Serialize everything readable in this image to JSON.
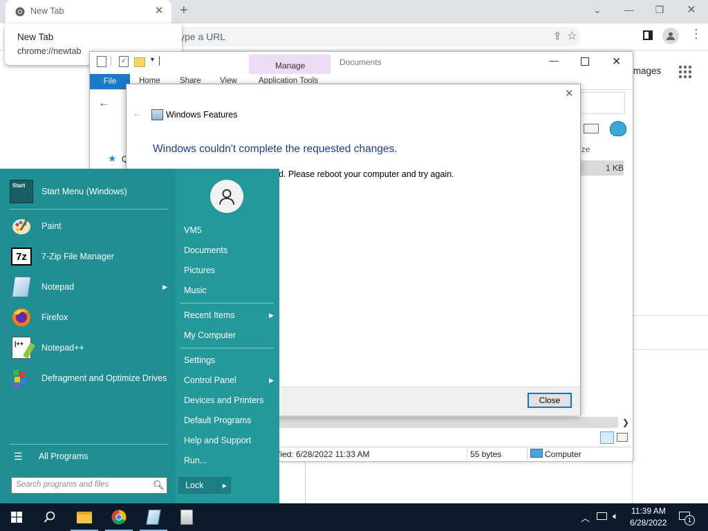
{
  "chrome": {
    "tab_title": "New Tab",
    "tooltip_title": "New Tab",
    "tooltip_url": "chrome://newtab",
    "omnibox_placeholder": "ype a URL",
    "images_link": "Images"
  },
  "explorer": {
    "title": "Documents",
    "manage_label": "Manage",
    "ribbon_tabs": [
      "File",
      "Home",
      "Share",
      "View",
      "Application Tools"
    ],
    "nav_partial": "Q",
    "column_header_partial": "ize",
    "file_size": "1 KB",
    "status": {
      "modified": "fied: 6/28/2022 11:33 AM",
      "size": "55 bytes",
      "location": "Computer"
    }
  },
  "dialog": {
    "title": "Windows Features",
    "heading": "Windows couldn't complete the requested changes.",
    "message": "d. Please reboot your computer and try again.",
    "close_label": "Close"
  },
  "start_menu": {
    "pinned": [
      {
        "label": "Start Menu (Windows)",
        "icon": "start-menu-icon"
      },
      {
        "label": "Paint",
        "icon": "paint-icon"
      },
      {
        "label": "7-Zip File Manager",
        "icon": "7zip-icon"
      },
      {
        "label": "Notepad",
        "icon": "notepad-icon",
        "submenu": true
      },
      {
        "label": "Firefox",
        "icon": "firefox-icon"
      },
      {
        "label": "Notepad++",
        "icon": "notepadpp-icon"
      },
      {
        "label": "Defragment and Optimize Drives",
        "icon": "defrag-icon"
      }
    ],
    "all_programs": "All Programs",
    "search_placeholder": "Search programs and files",
    "user_name": "VM5",
    "right_items": [
      "Documents",
      "Pictures",
      "Music",
      "Recent Items",
      "My Computer",
      "Settings",
      "Control Panel",
      "Devices and Printers",
      "Default Programs",
      "Help and Support",
      "Run..."
    ],
    "lock_label": "Lock"
  },
  "taskbar": {
    "time": "11:39 AM",
    "date": "6/28/2022",
    "notification_count": "1"
  }
}
